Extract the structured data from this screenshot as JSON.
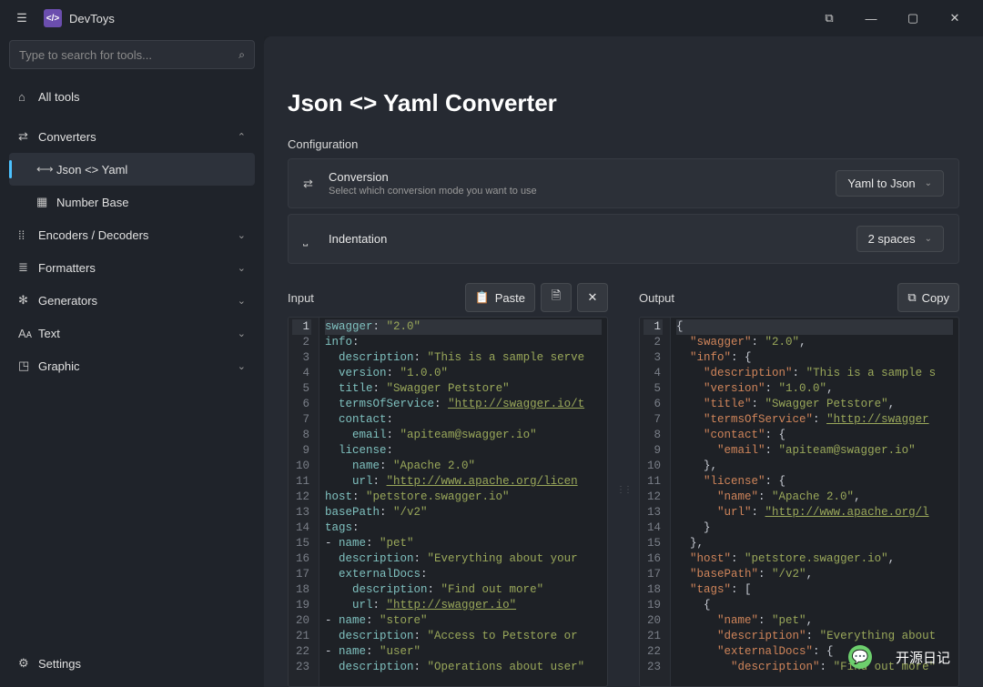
{
  "app": {
    "title": "DevToys"
  },
  "search": {
    "placeholder": "Type to search for tools..."
  },
  "sidebar": {
    "all_tools": "All tools",
    "converters": "Converters",
    "json_yaml": "Json <> Yaml",
    "number_base": "Number Base",
    "encoders": "Encoders / Decoders",
    "formatters": "Formatters",
    "generators": "Generators",
    "text": "Text",
    "graphic": "Graphic",
    "settings": "Settings"
  },
  "page": {
    "title": "Json <> Yaml Converter",
    "config_label": "Configuration",
    "conversion": {
      "title": "Conversion",
      "desc": "Select which conversion mode you want to use",
      "value": "Yaml to Json"
    },
    "indentation": {
      "title": "Indentation",
      "value": "2 spaces"
    }
  },
  "panes": {
    "input_label": "Input",
    "output_label": "Output",
    "paste": "Paste",
    "copy": "Copy"
  },
  "input_lines": [
    [
      [
        "key",
        "swagger"
      ],
      [
        "punc",
        ": "
      ],
      [
        "str",
        "\"2.0\""
      ]
    ],
    [
      [
        "key",
        "info"
      ],
      [
        "punc",
        ":"
      ]
    ],
    [
      [
        "pad",
        "  "
      ],
      [
        "key",
        "description"
      ],
      [
        "punc",
        ": "
      ],
      [
        "str",
        "\"This is a sample serve"
      ]
    ],
    [
      [
        "pad",
        "  "
      ],
      [
        "key",
        "version"
      ],
      [
        "punc",
        ": "
      ],
      [
        "str",
        "\"1.0.0\""
      ]
    ],
    [
      [
        "pad",
        "  "
      ],
      [
        "key",
        "title"
      ],
      [
        "punc",
        ": "
      ],
      [
        "str",
        "\"Swagger Petstore\""
      ]
    ],
    [
      [
        "pad",
        "  "
      ],
      [
        "key",
        "termsOfService"
      ],
      [
        "punc",
        ": "
      ],
      [
        "url",
        "\"http://swagger.io/t"
      ]
    ],
    [
      [
        "pad",
        "  "
      ],
      [
        "key",
        "contact"
      ],
      [
        "punc",
        ":"
      ]
    ],
    [
      [
        "pad",
        "    "
      ],
      [
        "key",
        "email"
      ],
      [
        "punc",
        ": "
      ],
      [
        "str",
        "\"apiteam@swagger.io\""
      ]
    ],
    [
      [
        "pad",
        "  "
      ],
      [
        "key",
        "license"
      ],
      [
        "punc",
        ":"
      ]
    ],
    [
      [
        "pad",
        "    "
      ],
      [
        "key",
        "name"
      ],
      [
        "punc",
        ": "
      ],
      [
        "str",
        "\"Apache 2.0\""
      ]
    ],
    [
      [
        "pad",
        "    "
      ],
      [
        "key",
        "url"
      ],
      [
        "punc",
        ": "
      ],
      [
        "url",
        "\"http://www.apache.org/licen"
      ]
    ],
    [
      [
        "key",
        "host"
      ],
      [
        "punc",
        ": "
      ],
      [
        "str",
        "\"petstore.swagger.io\""
      ]
    ],
    [
      [
        "key",
        "basePath"
      ],
      [
        "punc",
        ": "
      ],
      [
        "str",
        "\"/v2\""
      ]
    ],
    [
      [
        "key",
        "tags"
      ],
      [
        "punc",
        ":"
      ]
    ],
    [
      [
        "dash",
        "- "
      ],
      [
        "key",
        "name"
      ],
      [
        "punc",
        ": "
      ],
      [
        "str",
        "\"pet\""
      ]
    ],
    [
      [
        "pad",
        "  "
      ],
      [
        "key",
        "description"
      ],
      [
        "punc",
        ": "
      ],
      [
        "str",
        "\"Everything about your"
      ]
    ],
    [
      [
        "pad",
        "  "
      ],
      [
        "key",
        "externalDocs"
      ],
      [
        "punc",
        ":"
      ]
    ],
    [
      [
        "pad",
        "    "
      ],
      [
        "key",
        "description"
      ],
      [
        "punc",
        ": "
      ],
      [
        "str",
        "\"Find out more\""
      ]
    ],
    [
      [
        "pad",
        "    "
      ],
      [
        "key",
        "url"
      ],
      [
        "punc",
        ": "
      ],
      [
        "url",
        "\"http://swagger.io\""
      ]
    ],
    [
      [
        "dash",
        "- "
      ],
      [
        "key",
        "name"
      ],
      [
        "punc",
        ": "
      ],
      [
        "str",
        "\"store\""
      ]
    ],
    [
      [
        "pad",
        "  "
      ],
      [
        "key",
        "description"
      ],
      [
        "punc",
        ": "
      ],
      [
        "str",
        "\"Access to Petstore or"
      ]
    ],
    [
      [
        "dash",
        "- "
      ],
      [
        "key",
        "name"
      ],
      [
        "punc",
        ": "
      ],
      [
        "str",
        "\"user\""
      ]
    ],
    [
      [
        "pad",
        "  "
      ],
      [
        "key",
        "description"
      ],
      [
        "punc",
        ": "
      ],
      [
        "str",
        "\"Operations about user\""
      ]
    ]
  ],
  "output_lines": [
    [
      [
        "punc",
        "{"
      ]
    ],
    [
      [
        "pad",
        "  "
      ],
      [
        "keyj",
        "\"swagger\""
      ],
      [
        "punc",
        ": "
      ],
      [
        "str",
        "\"2.0\""
      ],
      [
        "punc",
        ","
      ]
    ],
    [
      [
        "pad",
        "  "
      ],
      [
        "keyj",
        "\"info\""
      ],
      [
        "punc",
        ": {"
      ]
    ],
    [
      [
        "pad",
        "    "
      ],
      [
        "keyj",
        "\"description\""
      ],
      [
        "punc",
        ": "
      ],
      [
        "str",
        "\"This is a sample s"
      ]
    ],
    [
      [
        "pad",
        "    "
      ],
      [
        "keyj",
        "\"version\""
      ],
      [
        "punc",
        ": "
      ],
      [
        "str",
        "\"1.0.0\""
      ],
      [
        "punc",
        ","
      ]
    ],
    [
      [
        "pad",
        "    "
      ],
      [
        "keyj",
        "\"title\""
      ],
      [
        "punc",
        ": "
      ],
      [
        "str",
        "\"Swagger Petstore\""
      ],
      [
        "punc",
        ","
      ]
    ],
    [
      [
        "pad",
        "    "
      ],
      [
        "keyj",
        "\"termsOfService\""
      ],
      [
        "punc",
        ": "
      ],
      [
        "url",
        "\"http://swagger"
      ]
    ],
    [
      [
        "pad",
        "    "
      ],
      [
        "keyj",
        "\"contact\""
      ],
      [
        "punc",
        ": {"
      ]
    ],
    [
      [
        "pad",
        "      "
      ],
      [
        "keyj",
        "\"email\""
      ],
      [
        "punc",
        ": "
      ],
      [
        "str",
        "\"apiteam@swagger.io\""
      ]
    ],
    [
      [
        "pad",
        "    "
      ],
      [
        "punc",
        "},"
      ]
    ],
    [
      [
        "pad",
        "    "
      ],
      [
        "keyj",
        "\"license\""
      ],
      [
        "punc",
        ": {"
      ]
    ],
    [
      [
        "pad",
        "      "
      ],
      [
        "keyj",
        "\"name\""
      ],
      [
        "punc",
        ": "
      ],
      [
        "str",
        "\"Apache 2.0\""
      ],
      [
        "punc",
        ","
      ]
    ],
    [
      [
        "pad",
        "      "
      ],
      [
        "keyj",
        "\"url\""
      ],
      [
        "punc",
        ": "
      ],
      [
        "url",
        "\"http://www.apache.org/l"
      ]
    ],
    [
      [
        "pad",
        "    "
      ],
      [
        "punc",
        "}"
      ]
    ],
    [
      [
        "pad",
        "  "
      ],
      [
        "punc",
        "},"
      ]
    ],
    [
      [
        "pad",
        "  "
      ],
      [
        "keyj",
        "\"host\""
      ],
      [
        "punc",
        ": "
      ],
      [
        "str",
        "\"petstore.swagger.io\""
      ],
      [
        "punc",
        ","
      ]
    ],
    [
      [
        "pad",
        "  "
      ],
      [
        "keyj",
        "\"basePath\""
      ],
      [
        "punc",
        ": "
      ],
      [
        "str",
        "\"/v2\""
      ],
      [
        "punc",
        ","
      ]
    ],
    [
      [
        "pad",
        "  "
      ],
      [
        "keyj",
        "\"tags\""
      ],
      [
        "punc",
        ": ["
      ]
    ],
    [
      [
        "pad",
        "    "
      ],
      [
        "punc",
        "{"
      ]
    ],
    [
      [
        "pad",
        "      "
      ],
      [
        "keyj",
        "\"name\""
      ],
      [
        "punc",
        ": "
      ],
      [
        "str",
        "\"pet\""
      ],
      [
        "punc",
        ","
      ]
    ],
    [
      [
        "pad",
        "      "
      ],
      [
        "keyj",
        "\"description\""
      ],
      [
        "punc",
        ": "
      ],
      [
        "str",
        "\"Everything about"
      ]
    ],
    [
      [
        "pad",
        "      "
      ],
      [
        "keyj",
        "\"externalDocs\""
      ],
      [
        "punc",
        ": {"
      ]
    ],
    [
      [
        "pad",
        "        "
      ],
      [
        "keyj",
        "\"description\""
      ],
      [
        "punc",
        ": "
      ],
      [
        "str",
        "\"Find out more\""
      ]
    ]
  ],
  "watermark": "开源日记"
}
